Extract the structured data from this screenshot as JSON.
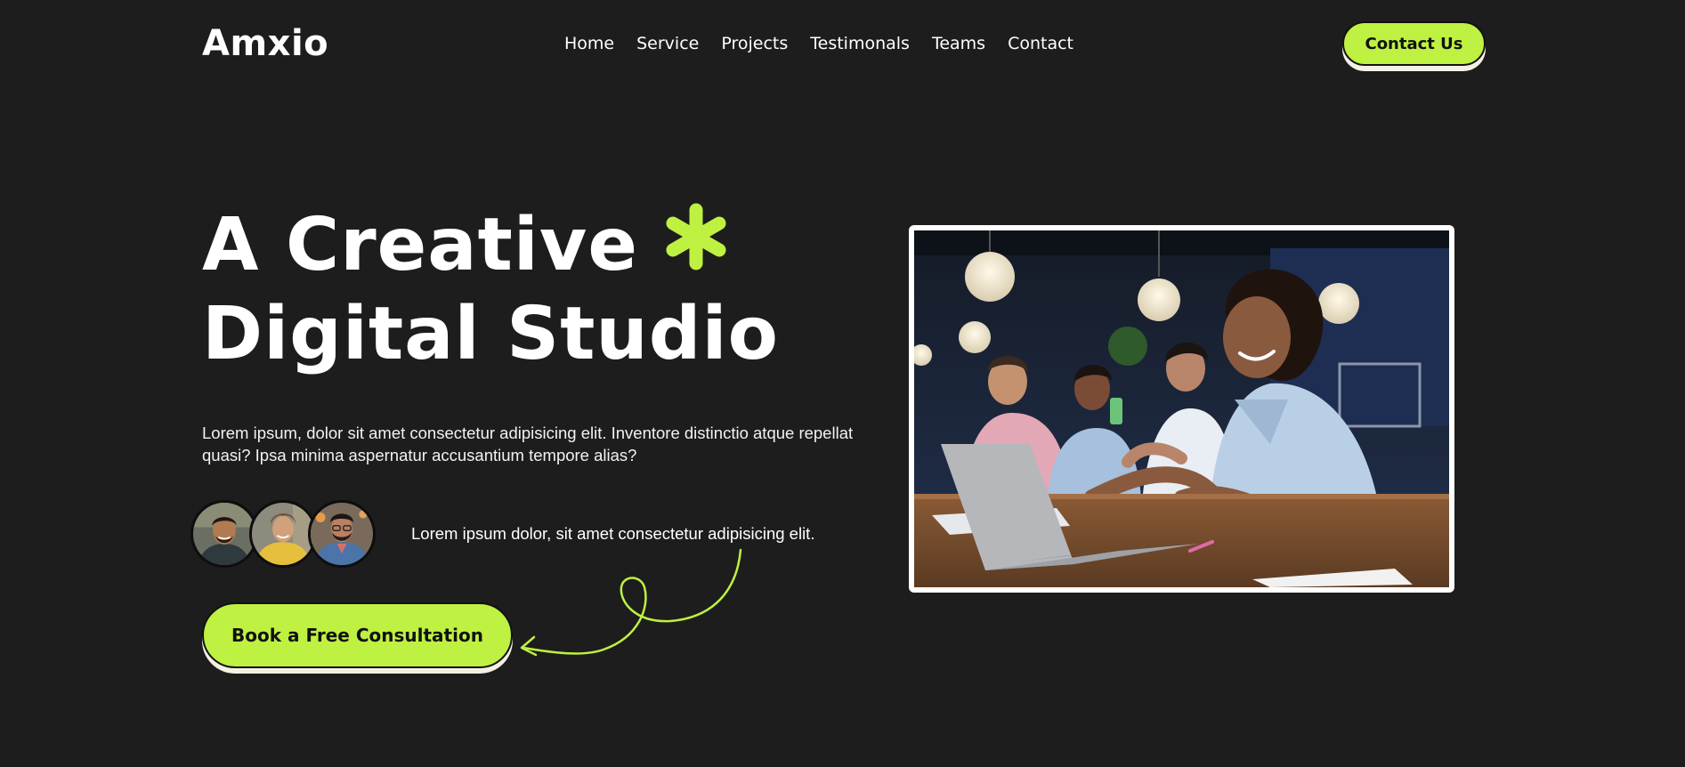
{
  "brand": {
    "logo_text": "Amxio"
  },
  "nav": {
    "items": [
      {
        "label": "Home"
      },
      {
        "label": "Service"
      },
      {
        "label": "Projects"
      },
      {
        "label": "Testimonals"
      },
      {
        "label": "Teams"
      },
      {
        "label": "Contact"
      }
    ],
    "cta_label": "Contact Us"
  },
  "hero": {
    "title_line1": "A Creative",
    "title_line2": "Digital Studio",
    "description": "Lorem ipsum, dolor sit amet consectetur adipisicing elit. Inventore distinctio atque repellat quasi? Ipsa minima aspernatur accusantium tempore alias?",
    "avatars_caption": "Lorem ipsum dolor, sit amet consectetur adipisicing elit.",
    "cta_label": "Book a Free Consultation",
    "avatar_icons": [
      "avatar-man-smiling",
      "avatar-man-yellow-hoodie",
      "avatar-man-beard-glasses"
    ],
    "photo_icon": "team-working-at-laptop-photo"
  },
  "colors": {
    "background": "#1d1d1d",
    "accent": "#bef141",
    "text": "#ffffff",
    "button_text": "#111111"
  }
}
